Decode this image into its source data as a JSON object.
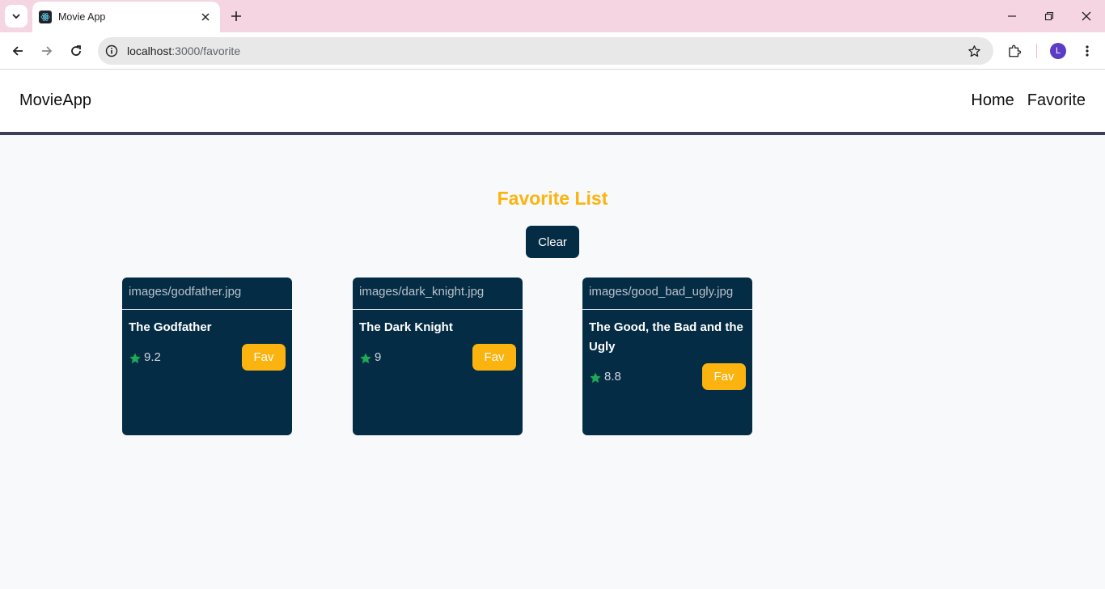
{
  "browser": {
    "tab_title": "Movie App",
    "url_host": "localhost",
    "url_path": ":3000/favorite",
    "profile_initial": "L"
  },
  "navbar": {
    "brand": "MovieApp",
    "links": [
      "Home",
      "Favorite"
    ]
  },
  "page": {
    "title": "Favorite List",
    "clear_label": "Clear"
  },
  "movies": [
    {
      "image": "images/godfather.jpg",
      "title": "The Godfather",
      "rating": "9.2",
      "fav_label": "Fav"
    },
    {
      "image": "images/dark_knight.jpg",
      "title": "The Dark Knight",
      "rating": "9",
      "fav_label": "Fav"
    },
    {
      "image": "images/good_bad_ugly.jpg",
      "title": "The Good, the Bad and the Ugly",
      "rating": "8.8",
      "fav_label": "Fav"
    }
  ],
  "colors": {
    "accent": "#fbb30f",
    "card_bg": "#052c45",
    "star": "#1eab53",
    "tabstrip": "#f6d5e3"
  },
  "icons": [
    "tab-search-icon",
    "react-favicon-icon",
    "close-icon",
    "plus-icon",
    "minimize-icon",
    "restore-icon",
    "back-arrow-icon",
    "forward-arrow-icon",
    "reload-icon",
    "info-icon",
    "bookmark-star-icon",
    "extensions-icon",
    "more-vert-icon",
    "star-icon"
  ]
}
